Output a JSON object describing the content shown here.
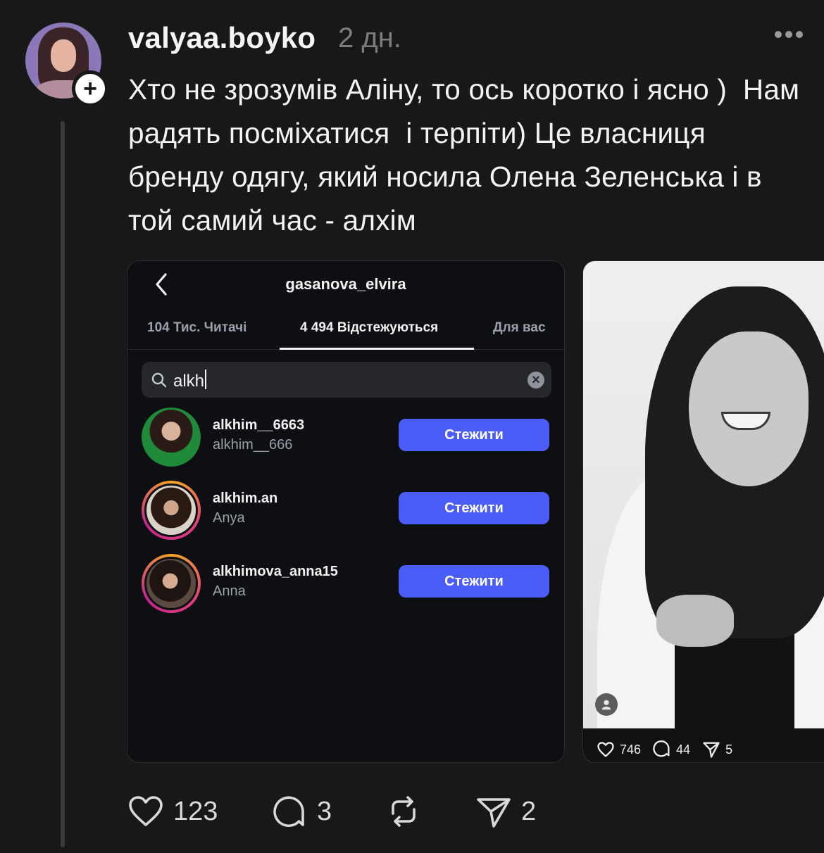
{
  "post": {
    "username": "valyaa.boyko",
    "timestamp": "2 дн.",
    "text": "Хто не зрозумів Аліну, то ось коротко і ясно )  Нам радять посміхатися  і терпіти) Це власниця бренду одягу, який носила Олена Зеленська і в той самий час - алхім"
  },
  "screenshot1": {
    "profile_name": "gasanova_elvira",
    "tabs": [
      "104 Тис. Читачі",
      "4 494 Відстежуються",
      "Для вас"
    ],
    "active_tab": "4 494 Відстежуються",
    "search_value": "alkh",
    "accounts": [
      {
        "handle": "alkhim__6663",
        "name": "alkhim__666",
        "button": "Стежити",
        "story_ring": false
      },
      {
        "handle": "alkhim.an",
        "name": "Anya",
        "button": "Стежити",
        "story_ring": true
      },
      {
        "handle": "alkhimova_anna15",
        "name": "Anna",
        "button": "Стежити",
        "story_ring": true
      }
    ]
  },
  "screenshot2": {
    "likes": "746",
    "comments": "44",
    "shares": "5"
  },
  "actions": {
    "likes": "123",
    "comments": "3",
    "reposts": "",
    "shares": "2"
  },
  "colors": {
    "background": "#181818",
    "follow_button": "#4a5df9",
    "muted_text": "#7d7d7d"
  }
}
